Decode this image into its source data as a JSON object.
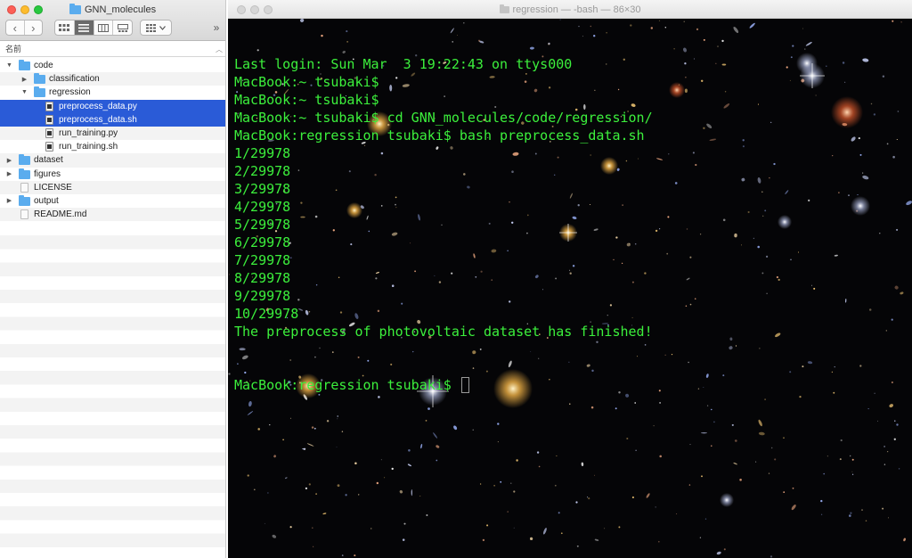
{
  "finder": {
    "title": "GNN_molecules",
    "nav_back": "‹",
    "nav_forward": "›",
    "more": "»",
    "column_header": "名前",
    "items": [
      {
        "label": "code",
        "type": "folder",
        "level": 0,
        "expanded": true,
        "selected": false
      },
      {
        "label": "classification",
        "type": "folder",
        "level": 1,
        "expanded": false,
        "selected": false
      },
      {
        "label": "regression",
        "type": "folder",
        "level": 1,
        "expanded": true,
        "selected": false
      },
      {
        "label": "preprocess_data.py",
        "type": "script",
        "level": 2,
        "selected": true
      },
      {
        "label": "preprocess_data.sh",
        "type": "script",
        "level": 2,
        "selected": true
      },
      {
        "label": "run_training.py",
        "type": "script",
        "level": 2,
        "selected": false
      },
      {
        "label": "run_training.sh",
        "type": "script",
        "level": 2,
        "selected": false
      },
      {
        "label": "dataset",
        "type": "folder",
        "level": 0,
        "expanded": false,
        "selected": false
      },
      {
        "label": "figures",
        "type": "folder",
        "level": 0,
        "expanded": false,
        "selected": false
      },
      {
        "label": "LICENSE",
        "type": "file",
        "level": 0,
        "selected": false
      },
      {
        "label": "output",
        "type": "folder",
        "level": 0,
        "expanded": false,
        "selected": false
      },
      {
        "label": "README.md",
        "type": "file",
        "level": 0,
        "selected": false
      }
    ]
  },
  "terminal": {
    "title": "regression — -bash — 86×30",
    "text_color": "#3cf03c",
    "lines": [
      "Last login: Sun Mar  3 19:22:43 on ttys000",
      "MacBook:~ tsubaki$",
      "MacBook:~ tsubaki$",
      "MacBook:~ tsubaki$ cd GNN_molecules/code/regression/",
      "MacBook:regression tsubaki$ bash preprocess_data.sh",
      "1/29978",
      "2/29978",
      "3/29978",
      "4/29978",
      "5/29978",
      "6/29978",
      "7/29978",
      "8/29978",
      "9/29978",
      "10/29978",
      "The preprocess of photovoltaic dataset has finished!"
    ],
    "prompt": "MacBook:regression tsubaki$ "
  },
  "colors": {
    "selection": "#2a5bd7",
    "folder": "#5aacee",
    "terminal_bg": "#050507"
  }
}
